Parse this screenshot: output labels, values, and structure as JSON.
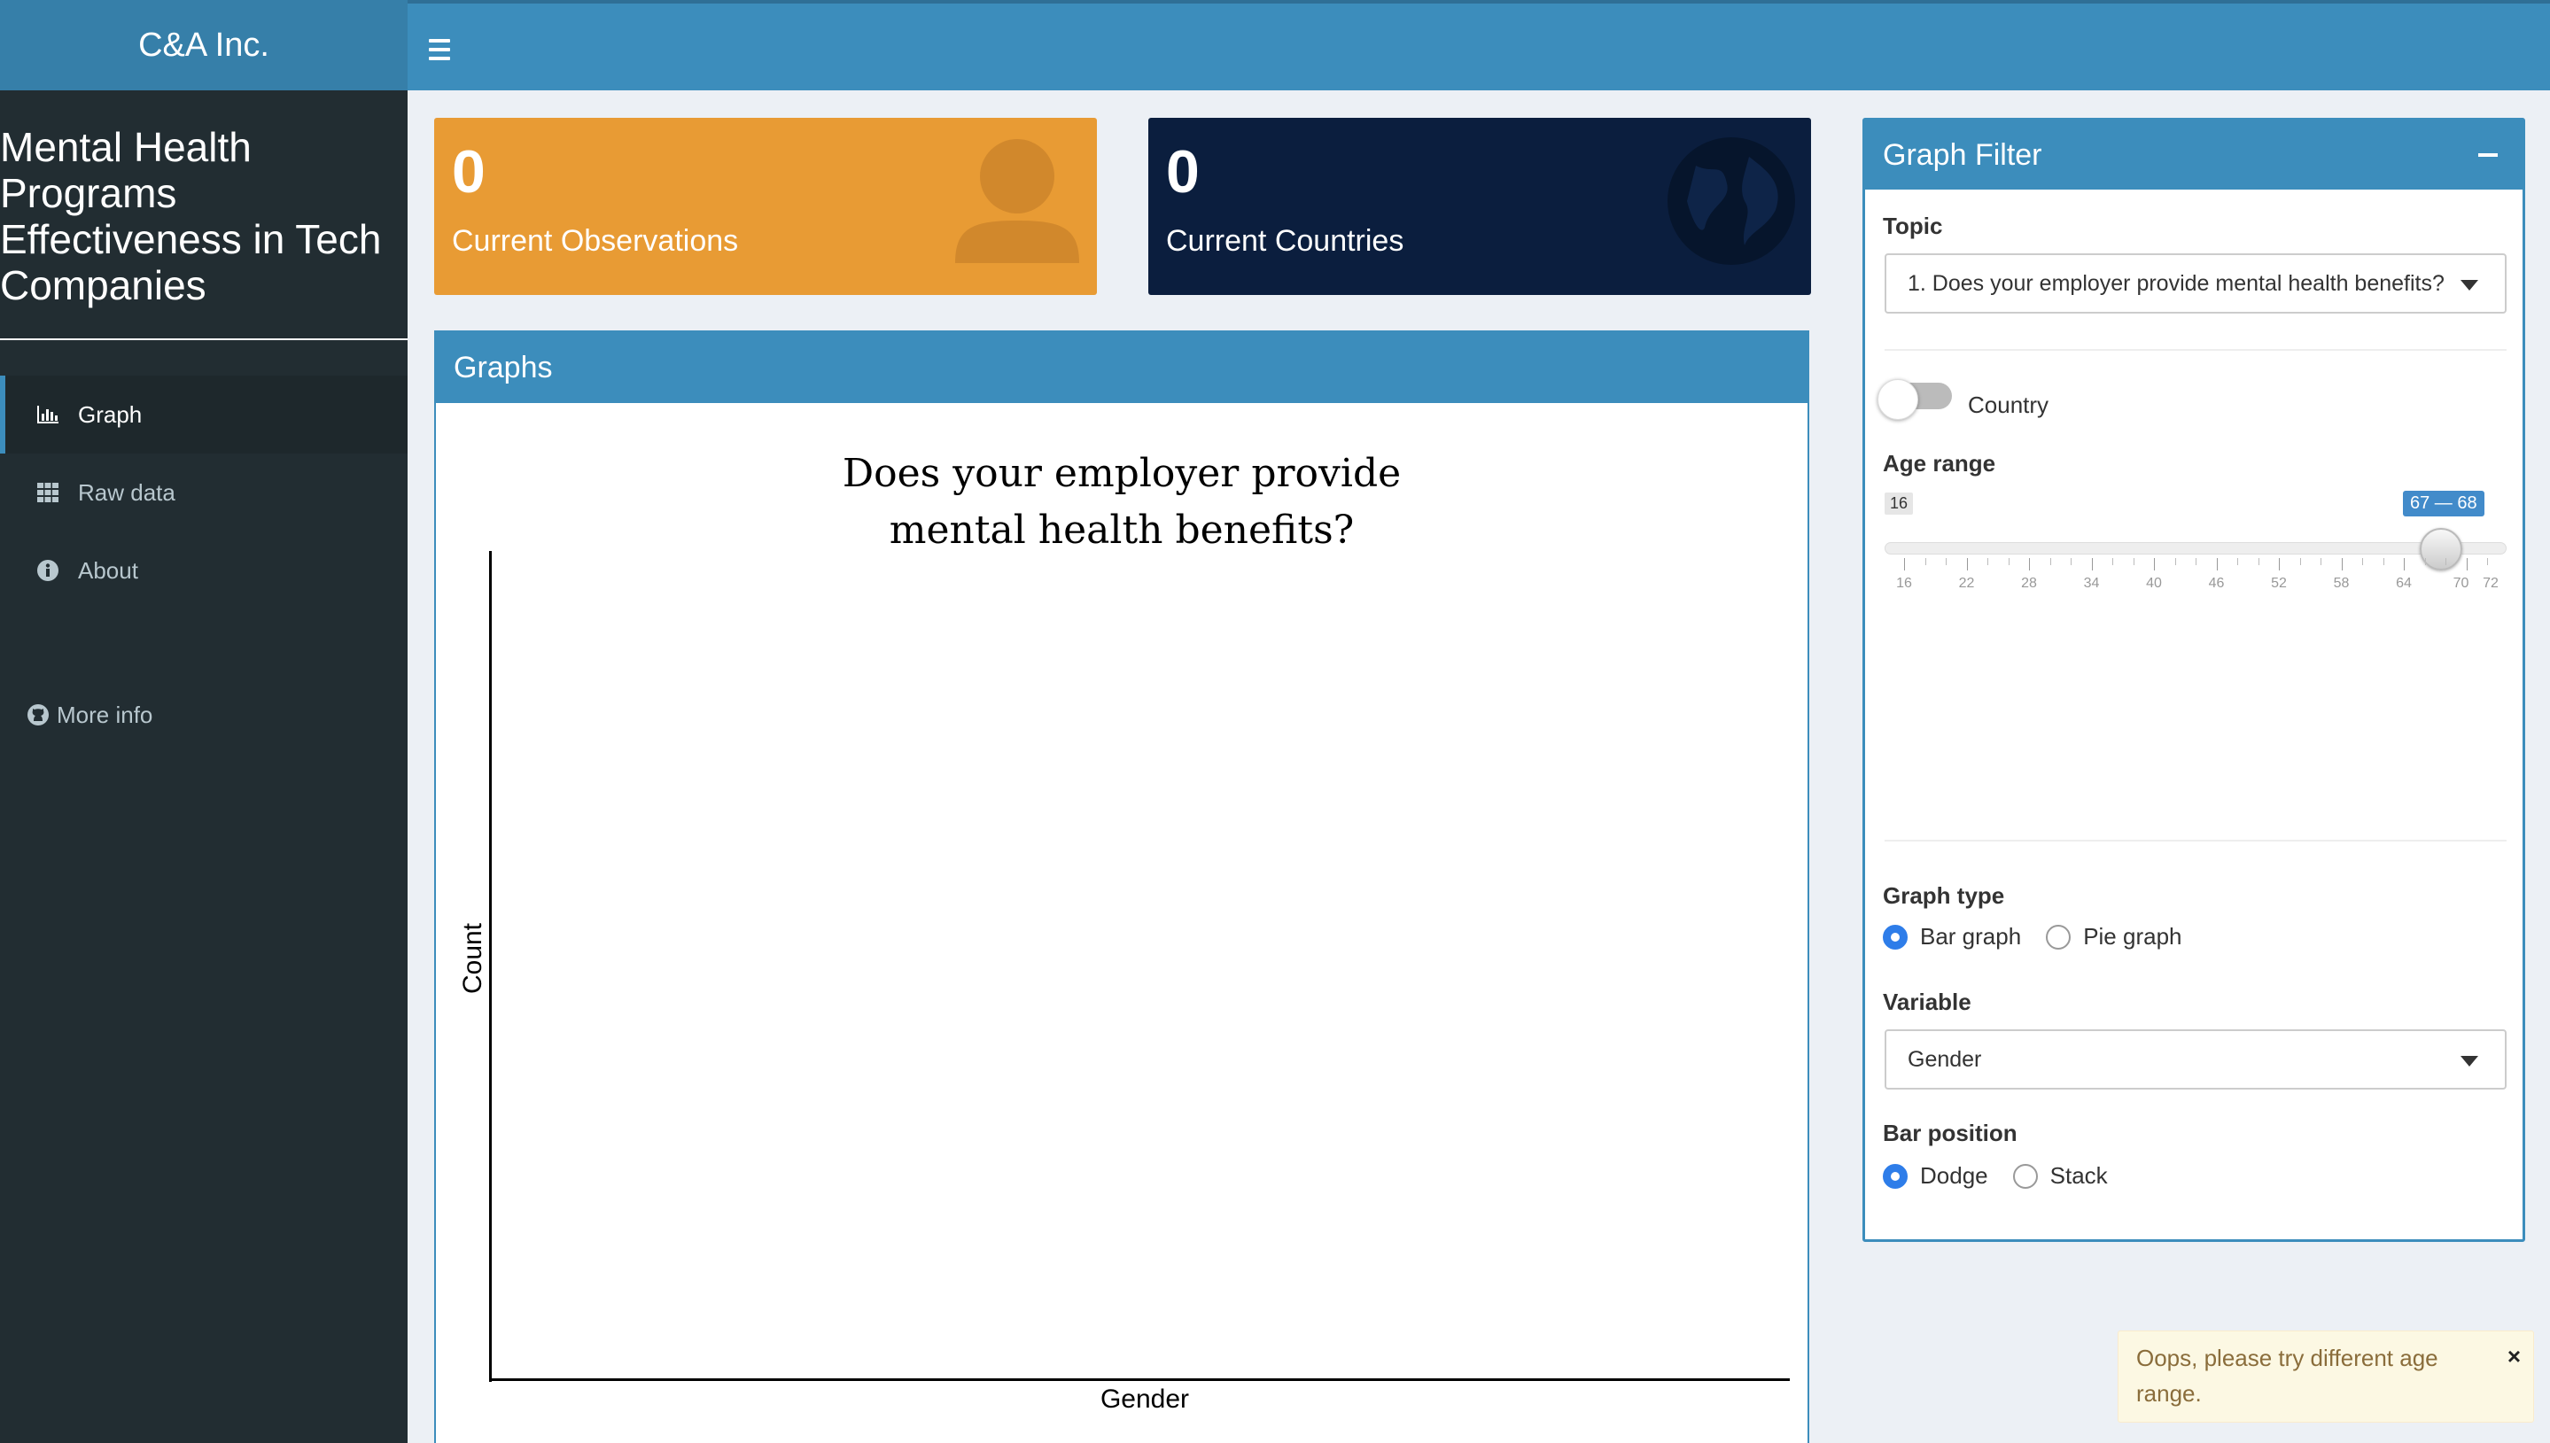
{
  "header": {
    "brand": "C&A Inc."
  },
  "sidebar": {
    "app_title": "Mental Health Programs Effectiveness in Tech Companies",
    "items": [
      {
        "label": "Graph",
        "icon": "bar-chart-icon",
        "active": true
      },
      {
        "label": "Raw data",
        "icon": "grid-icon",
        "active": false
      },
      {
        "label": "About",
        "icon": "info-icon",
        "active": false
      }
    ],
    "more_info": "More info"
  },
  "value_boxes": [
    {
      "value": "0",
      "label": "Current Observations",
      "icon": "user-icon",
      "color": "#e89b34"
    },
    {
      "value": "0",
      "label": "Current Countries",
      "icon": "globe-icon",
      "color": "#0b1e3e"
    }
  ],
  "graphs": {
    "header": "Graphs",
    "plot": {
      "title_line1": "Does your employer provide",
      "title_line2": "mental health benefits?",
      "xlabel": "Gender",
      "ylabel": "Count"
    }
  },
  "filter": {
    "header": "Graph Filter",
    "topic_label": "Topic",
    "topic_value": "1. Does your employer provide mental health benefits?",
    "country_toggle_label": "Country",
    "country_toggle_on": false,
    "age_range_label": "Age range",
    "age_min": "16",
    "age_selected": "67 — 68",
    "age_ticks": [
      "16",
      "22",
      "28",
      "34",
      "40",
      "46",
      "52",
      "58",
      "64",
      "70",
      "72"
    ],
    "graph_type_label": "Graph type",
    "graph_type_options": [
      "Bar graph",
      "Pie graph"
    ],
    "graph_type_selected": "Bar graph",
    "variable_label": "Variable",
    "variable_value": "Gender",
    "bar_position_label": "Bar position",
    "bar_position_options": [
      "Dodge",
      "Stack"
    ],
    "bar_position_selected": "Dodge"
  },
  "notification": {
    "text": "Oops, please try different age range.",
    "close": "×"
  },
  "colors": {
    "accent": "#3c8dbc",
    "sidebar": "#222d32",
    "warning": "#fcf8e3"
  }
}
